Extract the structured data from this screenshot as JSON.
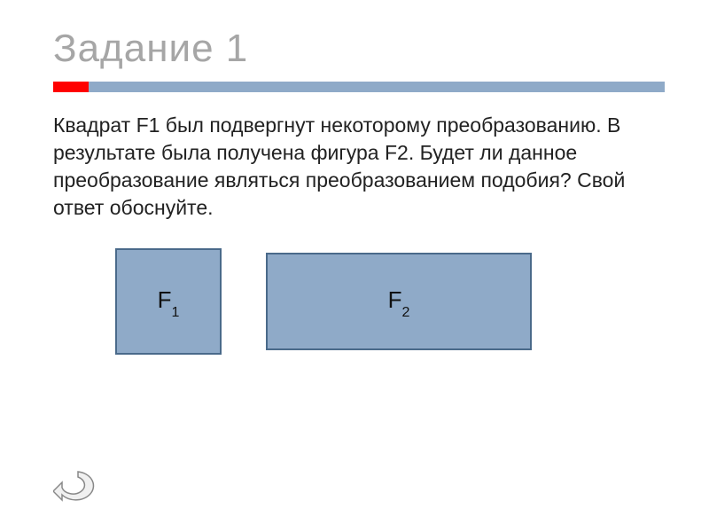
{
  "title": "Задание 1",
  "body_text": "Квадрат  F1 был подвергнут некоторому преобразованию. В результате была получена фигура F2. Будет ли данное преобразование являться преобразованием подобия? Свой ответ обоснуйте.",
  "shapes": {
    "f1": {
      "letter": "F",
      "sub": "1"
    },
    "f2": {
      "letter": "F",
      "sub": "2"
    }
  },
  "colors": {
    "title": "#a6a6a6",
    "accent_red": "#ff0000",
    "accent_blue": "#8faac8",
    "shape_border": "#4a6a8a"
  }
}
